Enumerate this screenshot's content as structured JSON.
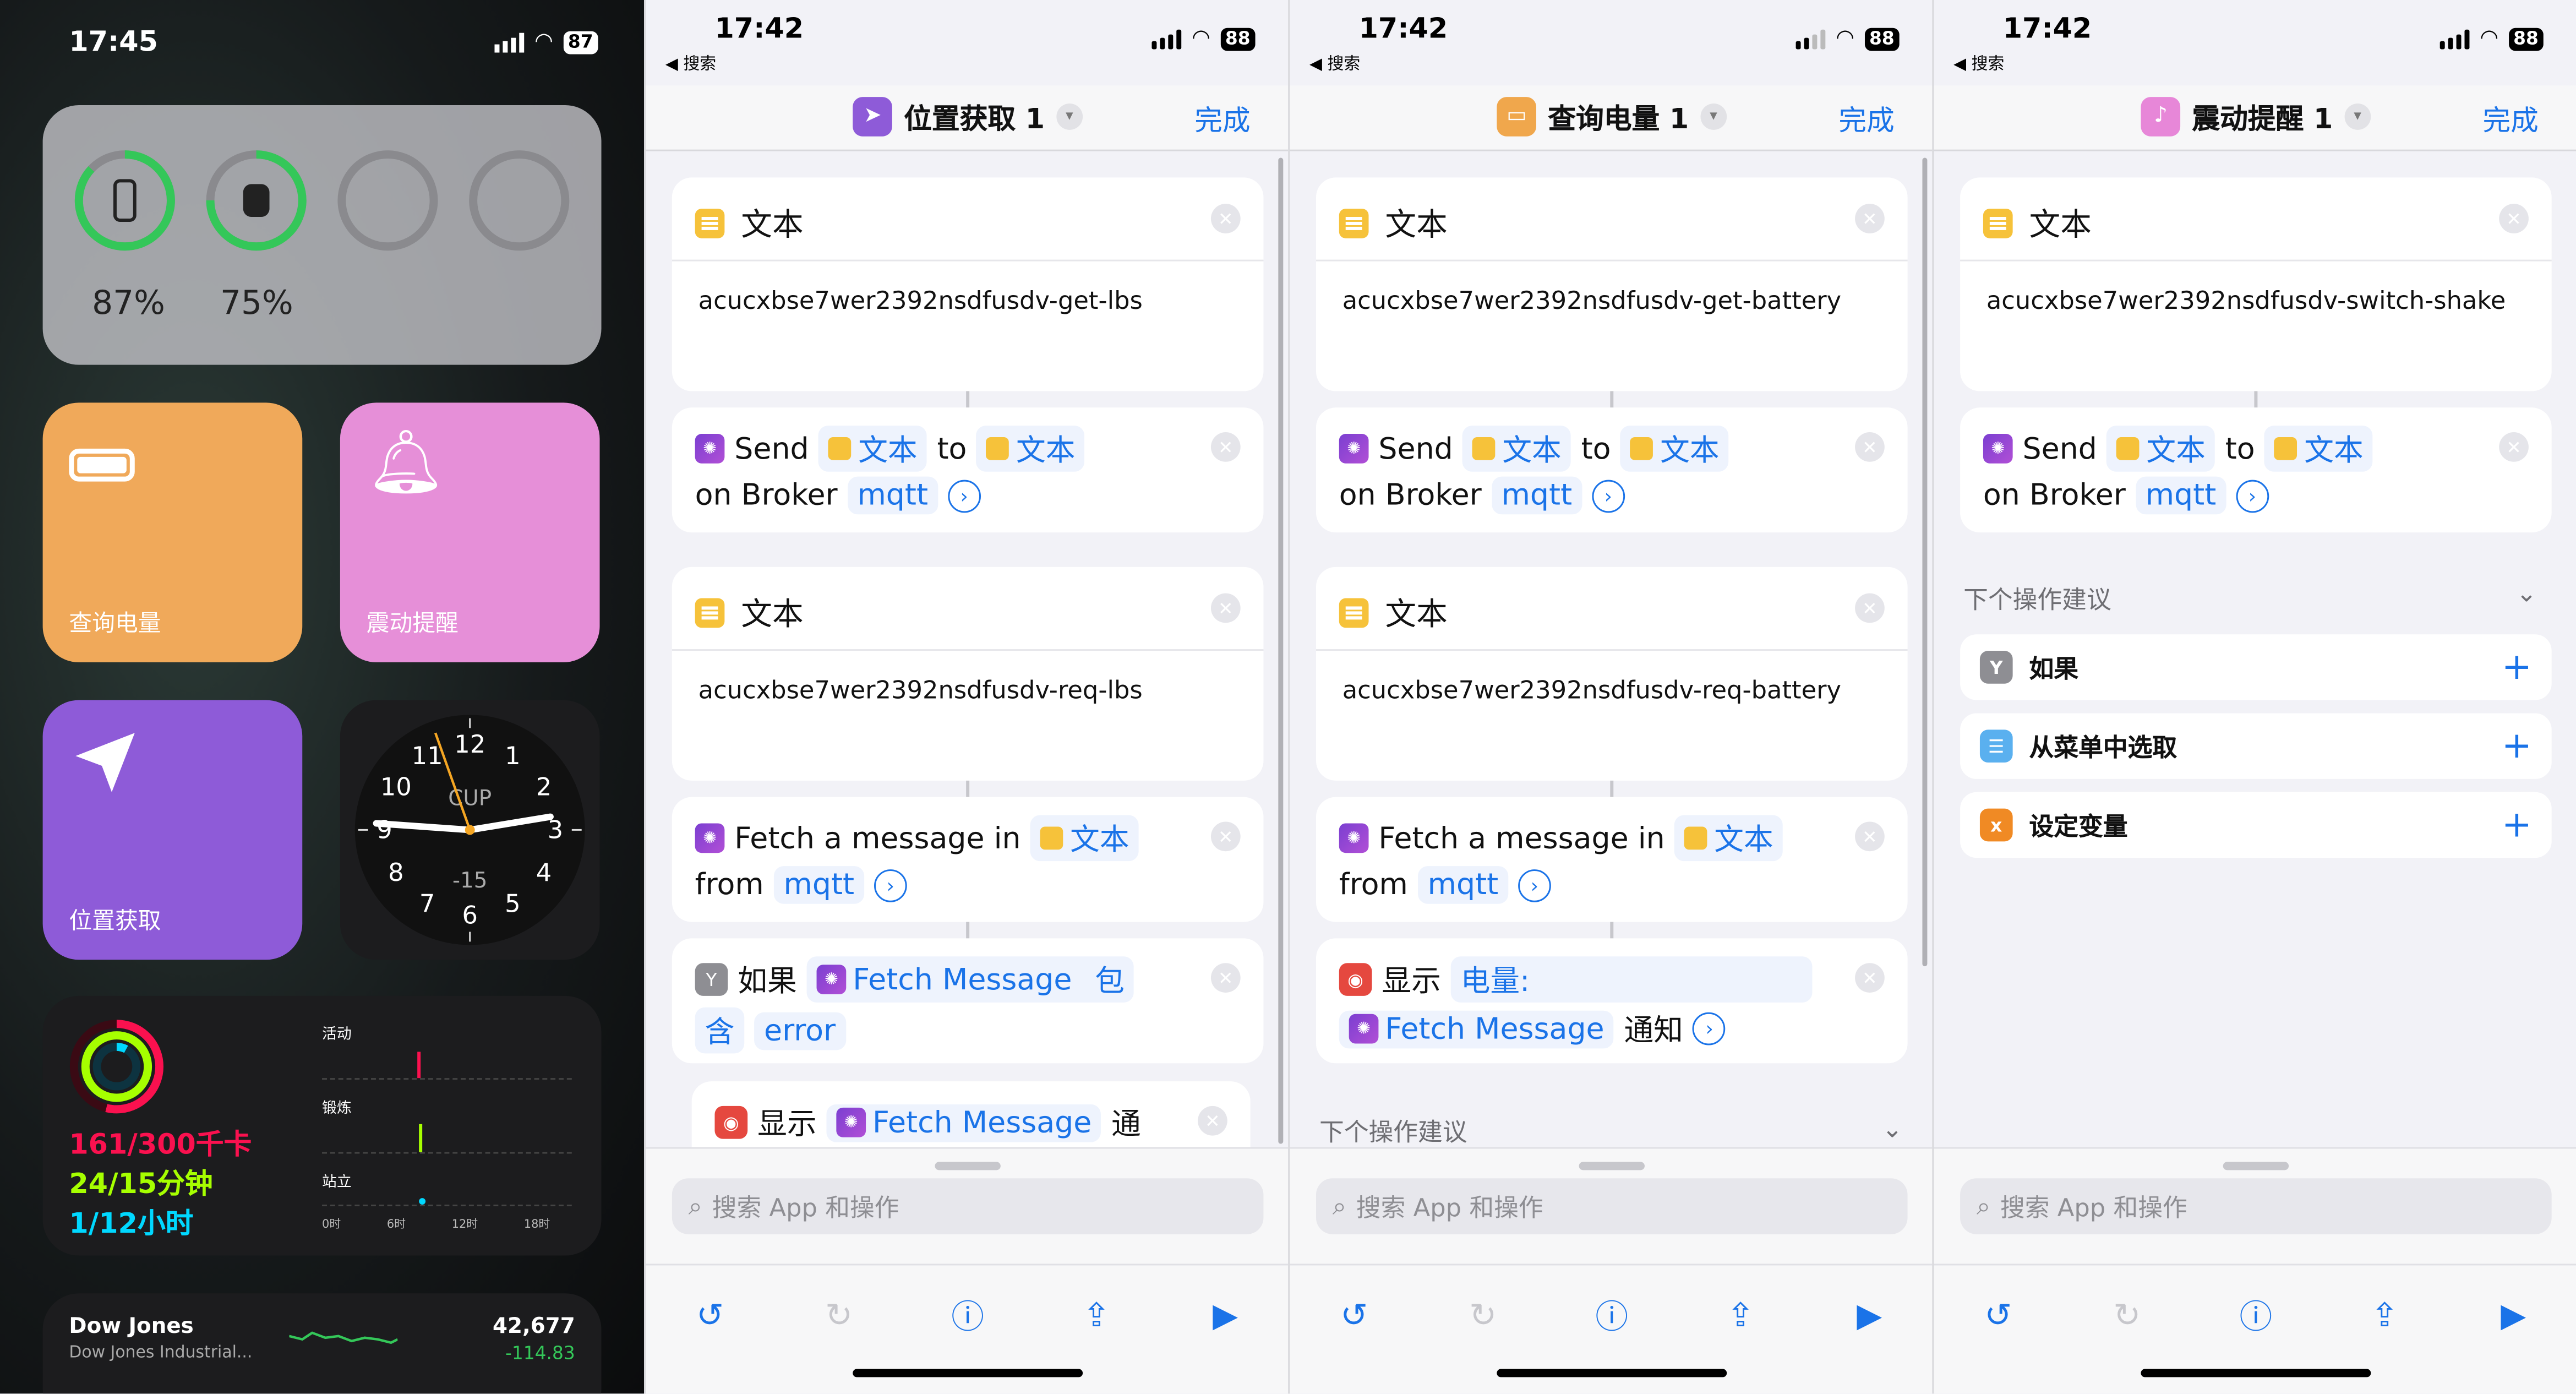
{
  "home": {
    "time": "17:45",
    "battery": "87",
    "battery_widget": {
      "phone_pct": "87%",
      "watch_pct": "75%"
    },
    "shortcut_battery": "查询电量",
    "shortcut_shake": "震动提醒",
    "shortcut_location": "位置获取",
    "clock": {
      "numbers": [
        "12",
        "1",
        "2",
        "3",
        "4",
        "5",
        "6",
        "7",
        "8",
        "9",
        "10",
        "11"
      ],
      "city": "CUP",
      "offset": "-15"
    },
    "activity": {
      "move": "161/300千卡",
      "exercise": "24/15分钟",
      "stand": "1/12小时",
      "label_move": "活动",
      "label_exercise": "锻炼",
      "label_stand": "站立",
      "ticks": [
        "0时",
        "6时",
        "12时",
        "18时"
      ],
      "colors": {
        "move": "#fa114f",
        "exercise": "#a6ff00",
        "stand": "#00d8ff"
      }
    },
    "stocks": {
      "name": "Dow Jones",
      "subtitle": "Dow Jones Industrial...",
      "value": "42,677",
      "change": "-114.83"
    }
  },
  "panels": [
    {
      "time": "17:42",
      "back": "◀ 搜索",
      "battery": "88",
      "title": "位置获取 1",
      "icon_color": "#8e5bd8",
      "done": "完成",
      "text1": {
        "header": "文本",
        "body": "acucxbse7wer2392nsdfusdv-get-lbs"
      },
      "send": {
        "w_send": "Send",
        "var1": "文本",
        "w_to": "to",
        "var2": "文本",
        "w_on": "on Broker",
        "broker": "mqtt"
      },
      "text2": {
        "header": "文本",
        "body": "acucxbse7wer2392nsdfusdv-req-lbs"
      },
      "fetch": {
        "w_fetch": "Fetch a message in",
        "var": "文本",
        "w_from": "from",
        "broker": "mqtt"
      },
      "if_block": {
        "w_if": "如果",
        "var": "Fetch Message",
        "cond1": "包",
        "cond2": "含",
        "value": "error"
      },
      "show": {
        "w_show": "显示",
        "var": "Fetch Message",
        "tail": "通"
      },
      "search_placeholder": "搜索 App 和操作"
    },
    {
      "time": "17:42",
      "back": "◀ 搜索",
      "battery": "88",
      "title": "查询电量 1",
      "icon_color": "#f0a74c",
      "done": "完成",
      "text1": {
        "header": "文本",
        "body": "acucxbse7wer2392nsdfusdv-get-battery"
      },
      "send": {
        "w_send": "Send",
        "var1": "文本",
        "w_to": "to",
        "var2": "文本",
        "w_on": "on Broker",
        "broker": "mqtt"
      },
      "text2": {
        "header": "文本",
        "body": "acucxbse7wer2392nsdfusdv-req-battery"
      },
      "fetch": {
        "w_fetch": "Fetch a message in",
        "var": "文本",
        "w_from": "from",
        "broker": "mqtt"
      },
      "notify": {
        "w_show": "显示",
        "prefix": "电量:",
        "var": "Fetch Message",
        "tail": "通知"
      },
      "suggest_header": "下个操作建议",
      "search_placeholder": "搜索 App 和操作"
    },
    {
      "time": "17:42",
      "back": "◀ 搜索",
      "battery": "88",
      "title": "震动提醒 1",
      "icon_color": "#e787d8",
      "done": "完成",
      "text1": {
        "header": "文本",
        "body": "acucxbse7wer2392nsdfusdv-switch-shake"
      },
      "send": {
        "w_send": "Send",
        "var1": "文本",
        "w_to": "to",
        "var2": "文本",
        "w_on": "on Broker",
        "broker": "mqtt"
      },
      "suggest_header": "下个操作建议",
      "suggestions": [
        {
          "label": "如果",
          "icon": "if-icon",
          "color": "#8e8e93"
        },
        {
          "label": "从菜单中选取",
          "icon": "menu-icon",
          "color": "#5ab0ef"
        },
        {
          "label": "设定变量",
          "icon": "variable-icon",
          "color": "#f08a24"
        }
      ],
      "search_placeholder": "搜索 App 和操作"
    }
  ]
}
